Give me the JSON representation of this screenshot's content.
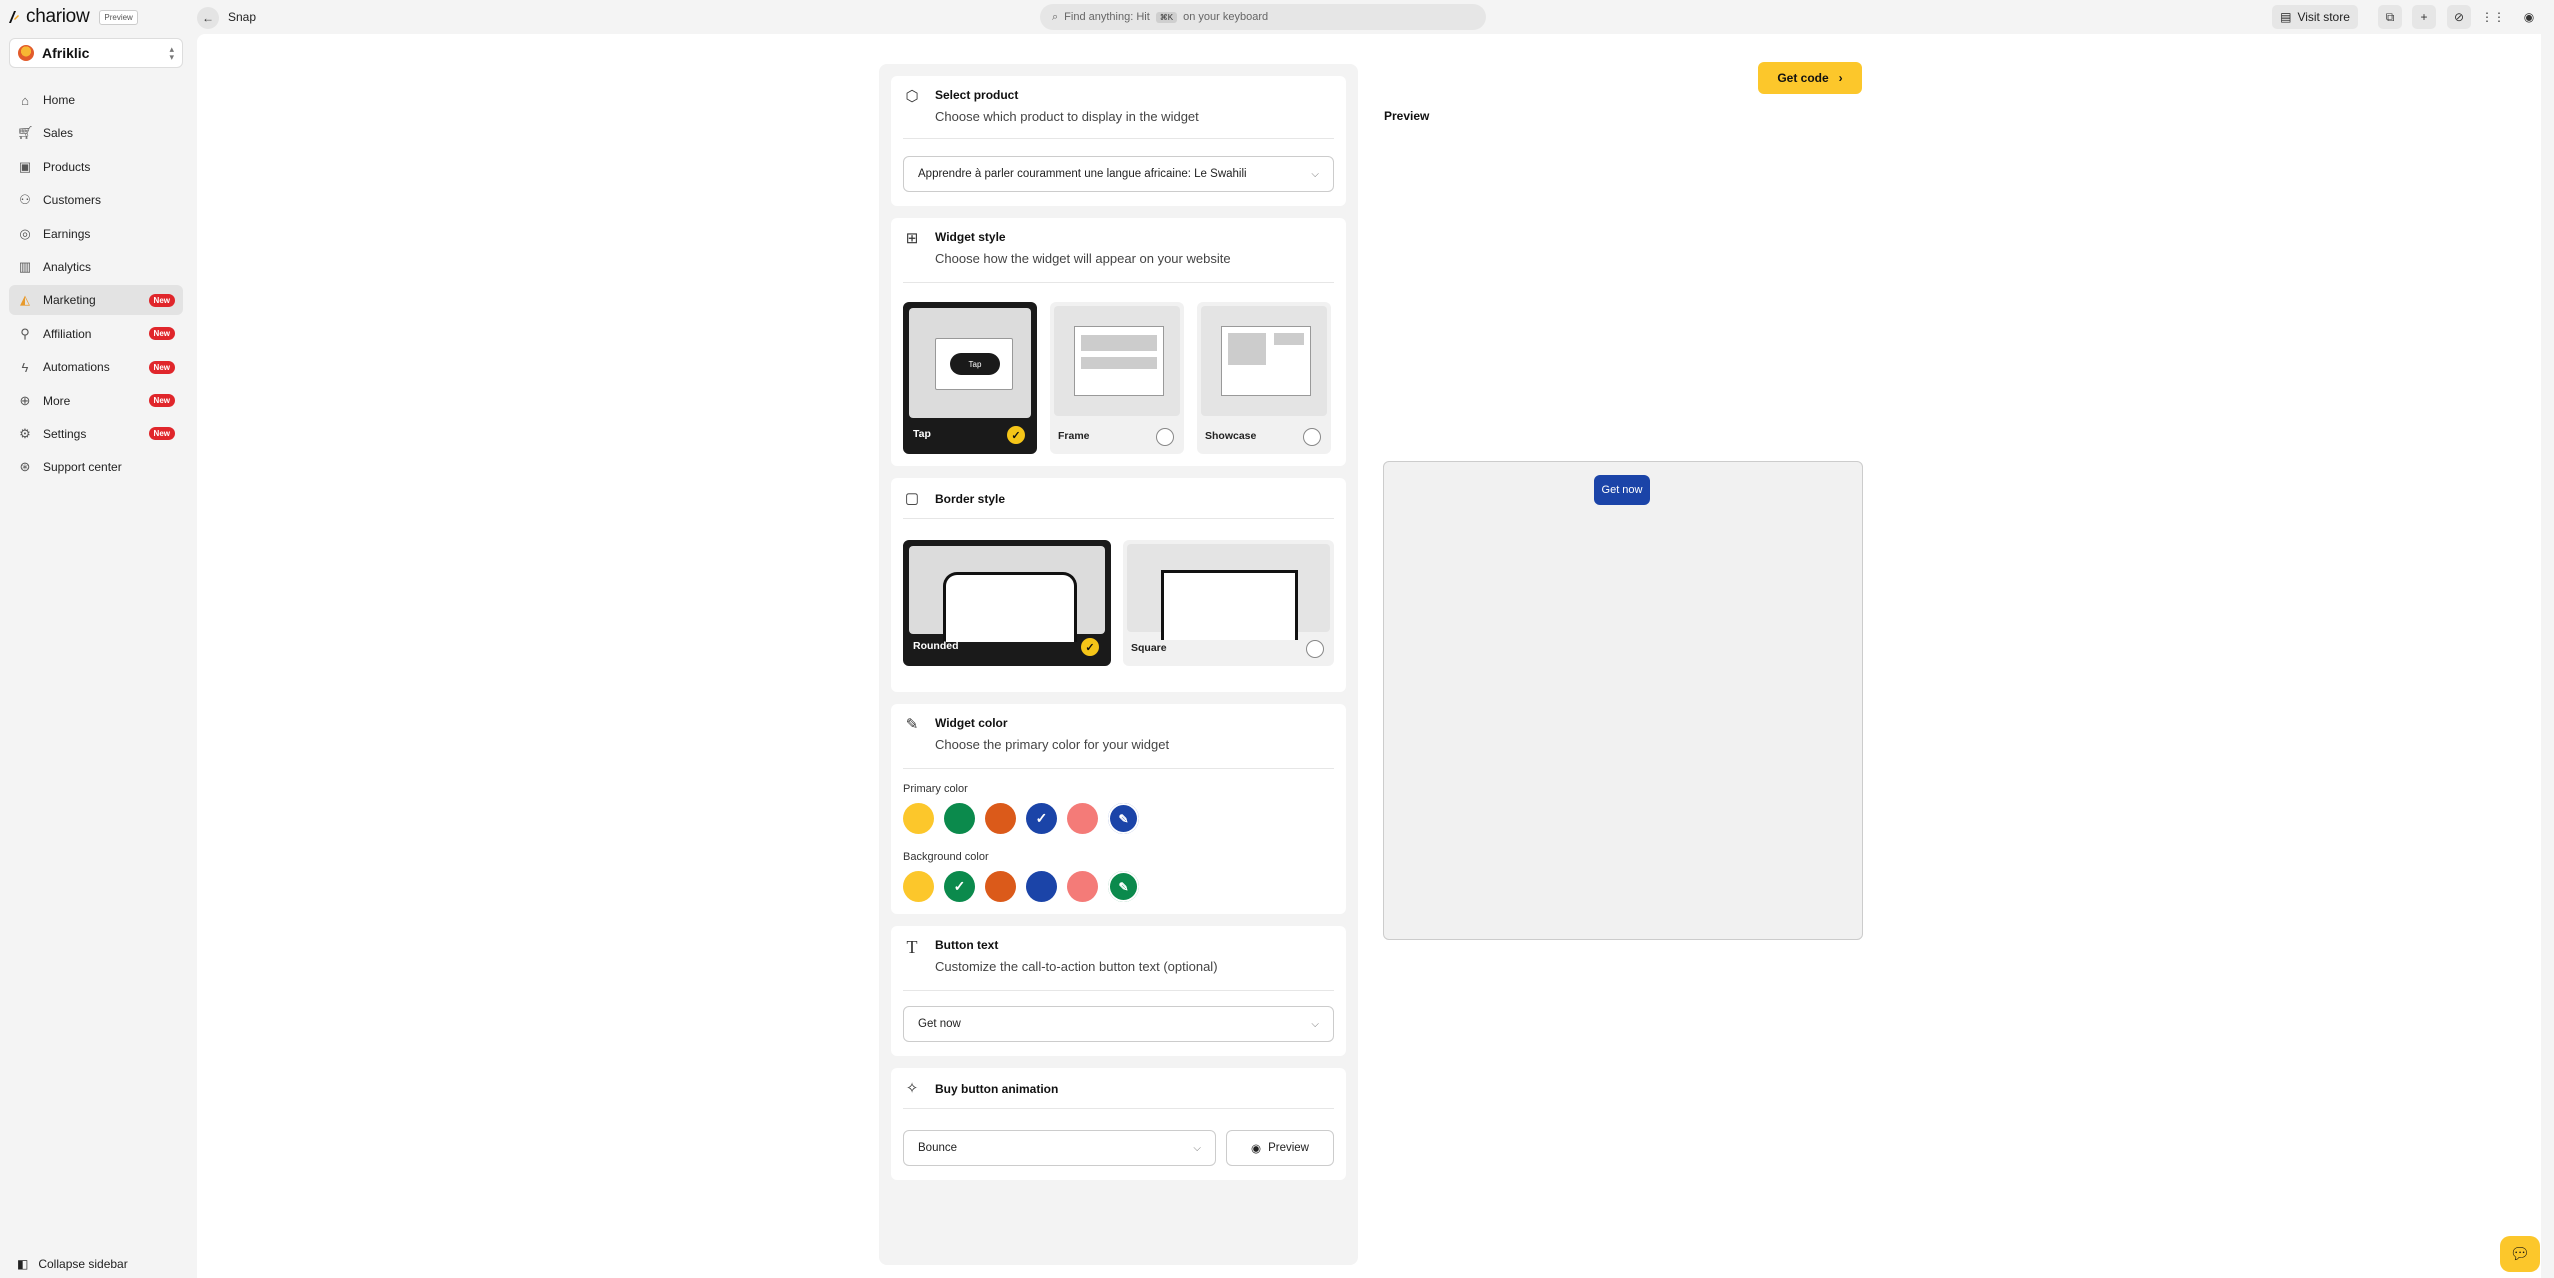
{
  "topbar": {
    "brand": "chariow",
    "preview_badge": "Preview",
    "page_title": "Snap",
    "search_placeholder": "Find anything: Hit",
    "search_shortcut": "⌘K",
    "search_suffix": "on your keyboard",
    "visit_store": "Visit store"
  },
  "sidebar": {
    "store_name": "Afriklic",
    "items": [
      {
        "label": "Home",
        "icon": "home-icon",
        "badge": ""
      },
      {
        "label": "Sales",
        "icon": "cart-icon",
        "badge": ""
      },
      {
        "label": "Products",
        "icon": "box-icon",
        "badge": ""
      },
      {
        "label": "Customers",
        "icon": "users-icon",
        "badge": ""
      },
      {
        "label": "Earnings",
        "icon": "coin-icon",
        "badge": ""
      },
      {
        "label": "Analytics",
        "icon": "chart-icon",
        "badge": ""
      },
      {
        "label": "Marketing",
        "icon": "megaphone-icon",
        "badge": "New"
      },
      {
        "label": "Affiliation",
        "icon": "user-link-icon",
        "badge": "New"
      },
      {
        "label": "Automations",
        "icon": "bolt-icon",
        "badge": "New"
      },
      {
        "label": "More",
        "icon": "plus-circle-icon",
        "badge": "New"
      },
      {
        "label": "Settings",
        "icon": "gear-icon",
        "badge": "New"
      },
      {
        "label": "Support center",
        "icon": "support-icon",
        "badge": ""
      }
    ],
    "collapse_label": "Collapse sidebar"
  },
  "select_product": {
    "title": "Select product",
    "subtitle": "Choose which product to display in the widget",
    "selected": "Apprendre à parler couramment une langue africaine: Le Swahili"
  },
  "widget_style": {
    "title": "Widget style",
    "subtitle": "Choose how the widget will appear on your website",
    "options": [
      {
        "label": "Tap",
        "thumb_text": "Tap"
      },
      {
        "label": "Frame"
      },
      {
        "label": "Showcase"
      }
    ],
    "selected": "Tap"
  },
  "border_style": {
    "title": "Border style",
    "options": [
      {
        "label": "Rounded"
      },
      {
        "label": "Square"
      }
    ],
    "selected": "Rounded"
  },
  "widget_color": {
    "title": "Widget color",
    "subtitle": "Choose the primary color for your widget",
    "primary_label": "Primary color",
    "background_label": "Background color",
    "palette": [
      "#fcc72b",
      "#0b8a4c",
      "#db5a1a",
      "#1b44a8",
      "#f47b78"
    ],
    "custom_primary": "#1b44a8",
    "custom_background": "#0b8a4c",
    "selected_primary": "#1b44a8",
    "selected_background": "#0b8a4c"
  },
  "button_text": {
    "title": "Button text",
    "subtitle": "Customize the call-to-action button text (optional)",
    "value": "Get now"
  },
  "buy_animation": {
    "title": "Buy button animation",
    "value": "Bounce",
    "preview_label": "Preview"
  },
  "preview": {
    "get_code": "Get code",
    "label": "Preview",
    "button_text": "Get now"
  }
}
